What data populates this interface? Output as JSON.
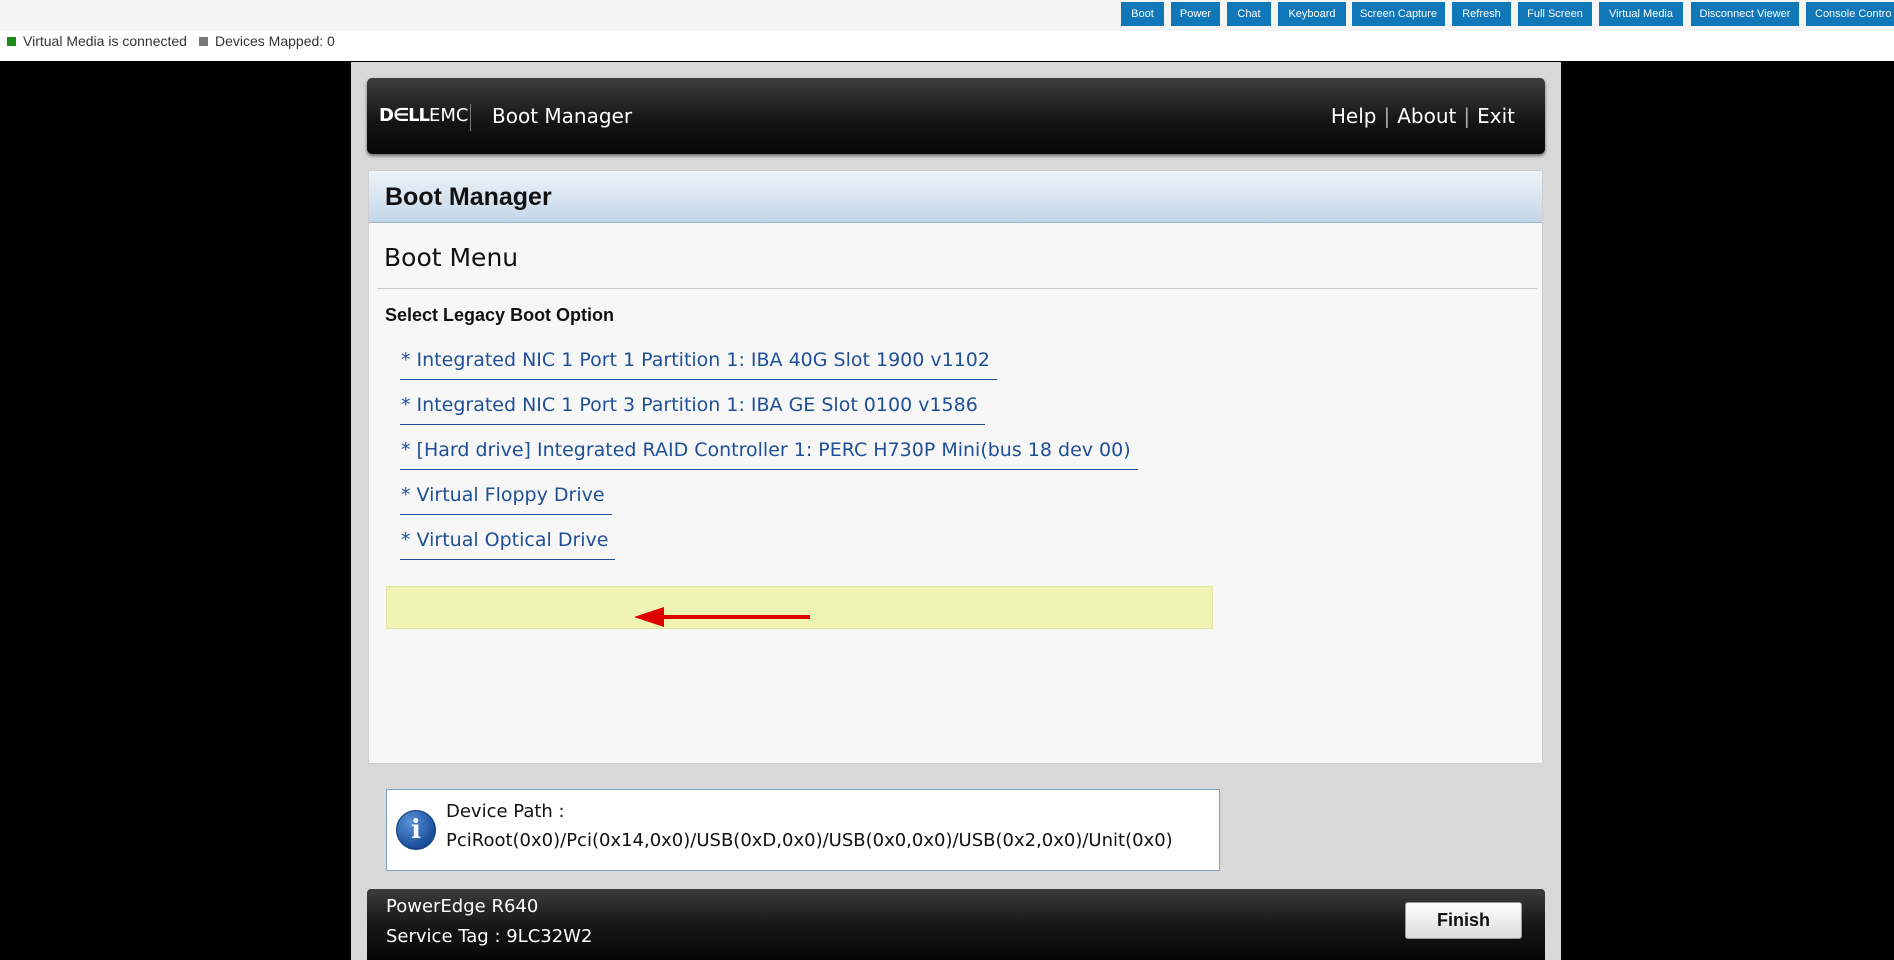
{
  "toolbar": {
    "buttons": [
      "Boot",
      "Power",
      "Chat",
      "Keyboard",
      "Screen Capture",
      "Refresh",
      "Full Screen",
      "Virtual Media",
      "Disconnect Viewer",
      "Console Contro"
    ]
  },
  "status": {
    "virtual_media": "Virtual Media is connected",
    "virtual_media_color": "#1a8a1a",
    "devices_mapped": "Devices Mapped: 0",
    "devices_mapped_color": "#777777"
  },
  "header": {
    "logo_dell": "D∈LL",
    "logo_emc": "EMC",
    "title": "Boot Manager",
    "links": [
      "Help",
      "About",
      "Exit"
    ],
    "separator": "|"
  },
  "panel": {
    "title": "Boot Manager",
    "menu_title": "Boot Menu",
    "subtitle": "Select Legacy Boot Option",
    "options": [
      "* Integrated NIC 1 Port 1 Partition 1: IBA 40G Slot 1900 v1102",
      "* Integrated NIC 1 Port 3 Partition 1: IBA GE Slot 0100 v1586",
      "* [Hard drive] Integrated RAID Controller 1: PERC H730P Mini(bus 18 dev 00)",
      "* Virtual Floppy Drive",
      "* Virtual Optical Drive"
    ],
    "selected_option_color": "#eef3b2",
    "annotation_arrow_color": "#e00000"
  },
  "device_path": {
    "label": "Device Path :",
    "value": "PciRoot(0x0)/Pci(0x14,0x0)/USB(0xD,0x0)/USB(0x0,0x0)/USB(0x2,0x0)/Unit(0x0)",
    "icon": "info-icon"
  },
  "footer": {
    "model": "PowerEdge R640",
    "service_tag": "Service Tag : 9LC32W2",
    "finish_label": "Finish"
  }
}
